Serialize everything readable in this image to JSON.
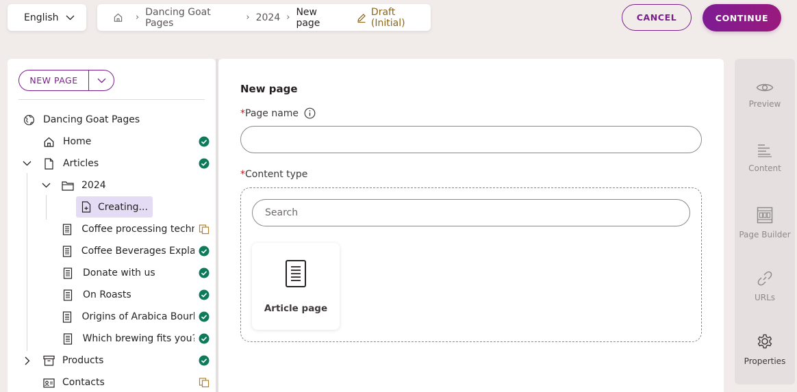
{
  "header": {
    "language": "English",
    "breadcrumb": [
      "Dancing Goat Pages",
      "2024",
      "New page"
    ],
    "status": "Draft (Initial)",
    "cancel_label": "CANCEL",
    "continue_label": "CONTINUE"
  },
  "tree": {
    "new_page_label": "NEW PAGE",
    "items": [
      {
        "label": "Dancing Goat Pages",
        "icon": "globe-icon",
        "status": ""
      },
      {
        "label": "Home",
        "icon": "home-icon",
        "status": "published"
      },
      {
        "label": "Articles",
        "icon": "page-icon",
        "status": "published",
        "expanded": true
      },
      {
        "label": "2024",
        "icon": "folder-icon",
        "status": "",
        "expanded": true
      },
      {
        "label": "Creating...",
        "icon": "new-page-icon",
        "status": ""
      },
      {
        "label": "Coffee processing techniq",
        "icon": "article-icon",
        "status": "draft"
      },
      {
        "label": "Coffee Beverages Explaine",
        "icon": "article-icon",
        "status": "published"
      },
      {
        "label": "Donate with us",
        "icon": "article-icon",
        "status": "published"
      },
      {
        "label": "On Roasts",
        "icon": "article-icon",
        "status": "published"
      },
      {
        "label": "Origins of Arabica Bourbo",
        "icon": "article-icon",
        "status": "published"
      },
      {
        "label": "Which brewing fits you?",
        "icon": "article-icon",
        "status": "published"
      },
      {
        "label": "Products",
        "icon": "archive-icon",
        "status": "published",
        "expanded": false
      },
      {
        "label": "Contacts",
        "icon": "contacts-icon",
        "status": "draft"
      }
    ]
  },
  "form": {
    "title": "New page",
    "required_mark": "*",
    "page_name_label": "Page name",
    "page_name_value": "",
    "content_type_label": "Content type",
    "search_placeholder": "Search",
    "content_types": [
      {
        "label": "Article page",
        "icon": "article-page-icon"
      }
    ]
  },
  "rail": {
    "items": [
      {
        "label": "Preview",
        "icon": "eye-icon",
        "active": false
      },
      {
        "label": "Content",
        "icon": "content-icon",
        "active": false
      },
      {
        "label": "Page Builder",
        "icon": "page-builder-icon",
        "active": false
      },
      {
        "label": "URLs",
        "icon": "link-icon",
        "active": false
      },
      {
        "label": "Properties",
        "icon": "gear-icon",
        "active": true
      }
    ]
  },
  "colors": {
    "accent": "#7b1c8c",
    "published": "#0f7a5a",
    "draft": "#b0822c",
    "background": "#f1ecea"
  }
}
